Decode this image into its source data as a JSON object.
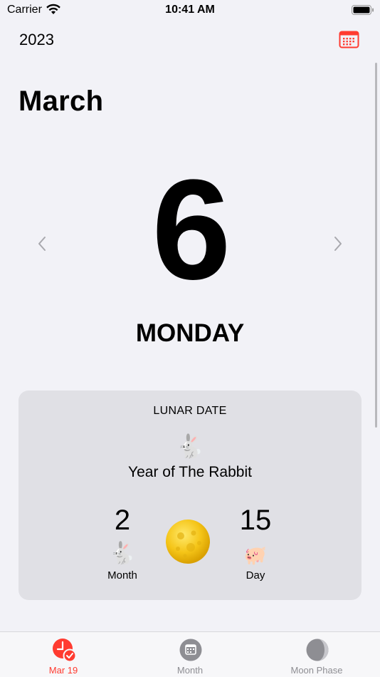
{
  "status_bar": {
    "carrier": "Carrier",
    "time": "10:41 AM"
  },
  "header": {
    "year": "2023",
    "calendar_icon": "calendar-grid-icon"
  },
  "month_title": "March",
  "day": {
    "number": "6",
    "weekday": "MONDAY"
  },
  "nav": {
    "prev_icon": "chevron-left-icon",
    "next_icon": "chevron-right-icon"
  },
  "lunar": {
    "title": "LUNAR DATE",
    "year_emoji": "🐇",
    "year_text": "Year of The Rabbit",
    "month": {
      "number": "2",
      "emoji": "🐇",
      "label": "Month"
    },
    "moon_icon": "full-moon-icon",
    "day": {
      "number": "15",
      "emoji": "🐖",
      "label": "Day"
    }
  },
  "tabs": [
    {
      "label": "Mar 19",
      "icon": "clock-check-icon",
      "active": true
    },
    {
      "label": "Month",
      "icon": "calendar-icon",
      "active": false
    },
    {
      "label": "Moon Phase",
      "icon": "moon-phase-icon",
      "active": false
    }
  ],
  "colors": {
    "accent": "#ff3b30",
    "background": "#f2f2f7",
    "card": "#e0e0e5",
    "inactive": "#8e8e93"
  }
}
